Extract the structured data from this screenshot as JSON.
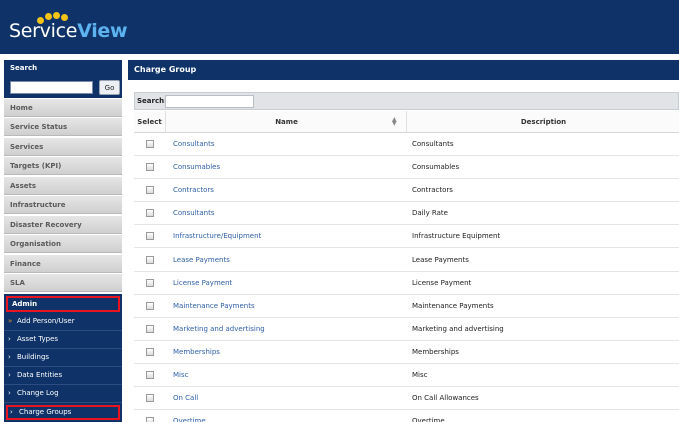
{
  "brand": {
    "logo_part1": "Service",
    "logo_part2": "View",
    "dot_color": "#f3c318",
    "header_color": "#0f3368"
  },
  "sidebar": {
    "search": {
      "title": "Search",
      "input_value": "",
      "go_label": "Go"
    },
    "nav": [
      "Home",
      "Service Status",
      "Services",
      "Targets (KPI)",
      "Assets",
      "Infrastructure",
      "Disaster Recovery",
      "Organisation",
      "Finance",
      "SLA"
    ],
    "admin": {
      "title": "Admin",
      "items": [
        "Add Person/User",
        "Asset Types",
        "Buildings",
        "Data Entities",
        "Change Log",
        "Charge Groups"
      ],
      "active_item": "Charge Groups"
    }
  },
  "main": {
    "title": "Charge Group",
    "filter": {
      "label": "Search:",
      "value": ""
    },
    "columns": {
      "select": "Select",
      "name": "Name",
      "description": "Description"
    },
    "rows": [
      {
        "name": "Consultants",
        "description": "Consultants"
      },
      {
        "name": "Consumables",
        "description": "Consumables"
      },
      {
        "name": "Contractors",
        "description": "Contractors"
      },
      {
        "name": "Consultants",
        "description": "Daily Rate"
      },
      {
        "name": "Infrastructure/Equipment",
        "description": "Infrastructure Equipment"
      },
      {
        "name": "Lease Payments",
        "description": "Lease Payments"
      },
      {
        "name": "License Payment",
        "description": "License Payment"
      },
      {
        "name": "Maintenance Payments",
        "description": "Maintenance Payments"
      },
      {
        "name": "Marketing and advertising",
        "description": "Marketing and advertising"
      },
      {
        "name": "Memberships",
        "description": "Memberships"
      },
      {
        "name": "Misc",
        "description": "Misc"
      },
      {
        "name": "On Call",
        "description": "On Call Allowances"
      },
      {
        "name": "Overtime",
        "description": "Overtime"
      }
    ]
  }
}
